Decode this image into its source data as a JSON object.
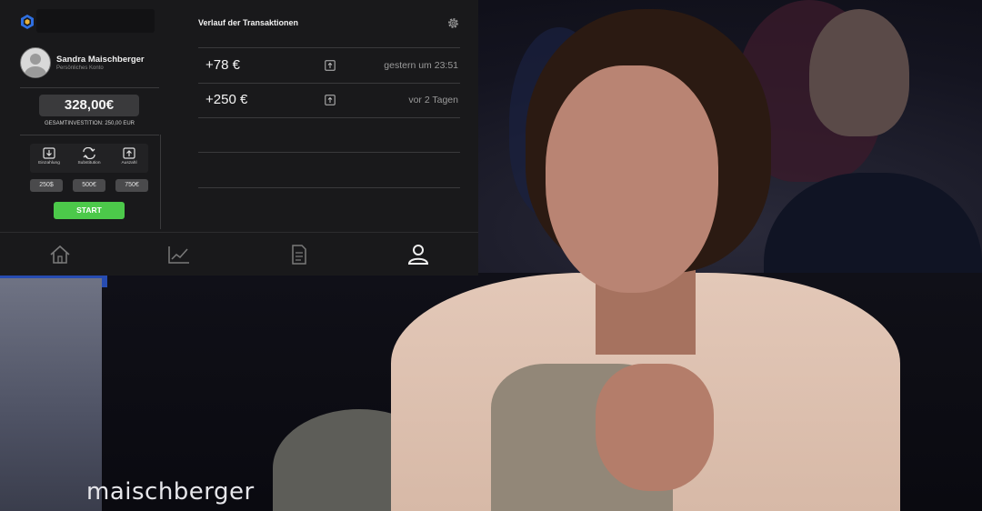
{
  "app": {
    "user": {
      "name": "Sandra Maischberger",
      "subtitle": "Persönliches Konto"
    },
    "balance": "328,00€",
    "total_investment": "GESAMTINVESTITION: 250,00 EUR",
    "actions": [
      {
        "label": "Einzahlung",
        "icon": "download-icon"
      },
      {
        "label": "Substitution",
        "icon": "swap-icon"
      },
      {
        "label": "Auszahl",
        "icon": "upload-icon"
      }
    ],
    "amounts": [
      "250$",
      "500€",
      "750€"
    ],
    "start_label": "START",
    "accent_color": "#4cc94a",
    "transactions": {
      "title": "Verlauf der Transaktionen",
      "rows": [
        {
          "amount": "+78 €",
          "time": "gestern um 23:51"
        },
        {
          "amount": "+250 €",
          "time": "vor 2 Tagen"
        }
      ]
    },
    "nav": [
      {
        "icon": "home-icon",
        "active": false
      },
      {
        "icon": "chart-icon",
        "active": false
      },
      {
        "icon": "document-icon",
        "active": false
      },
      {
        "icon": "profile-icon",
        "active": true
      }
    ]
  },
  "broadcast": {
    "show_logo": "maischberger"
  }
}
